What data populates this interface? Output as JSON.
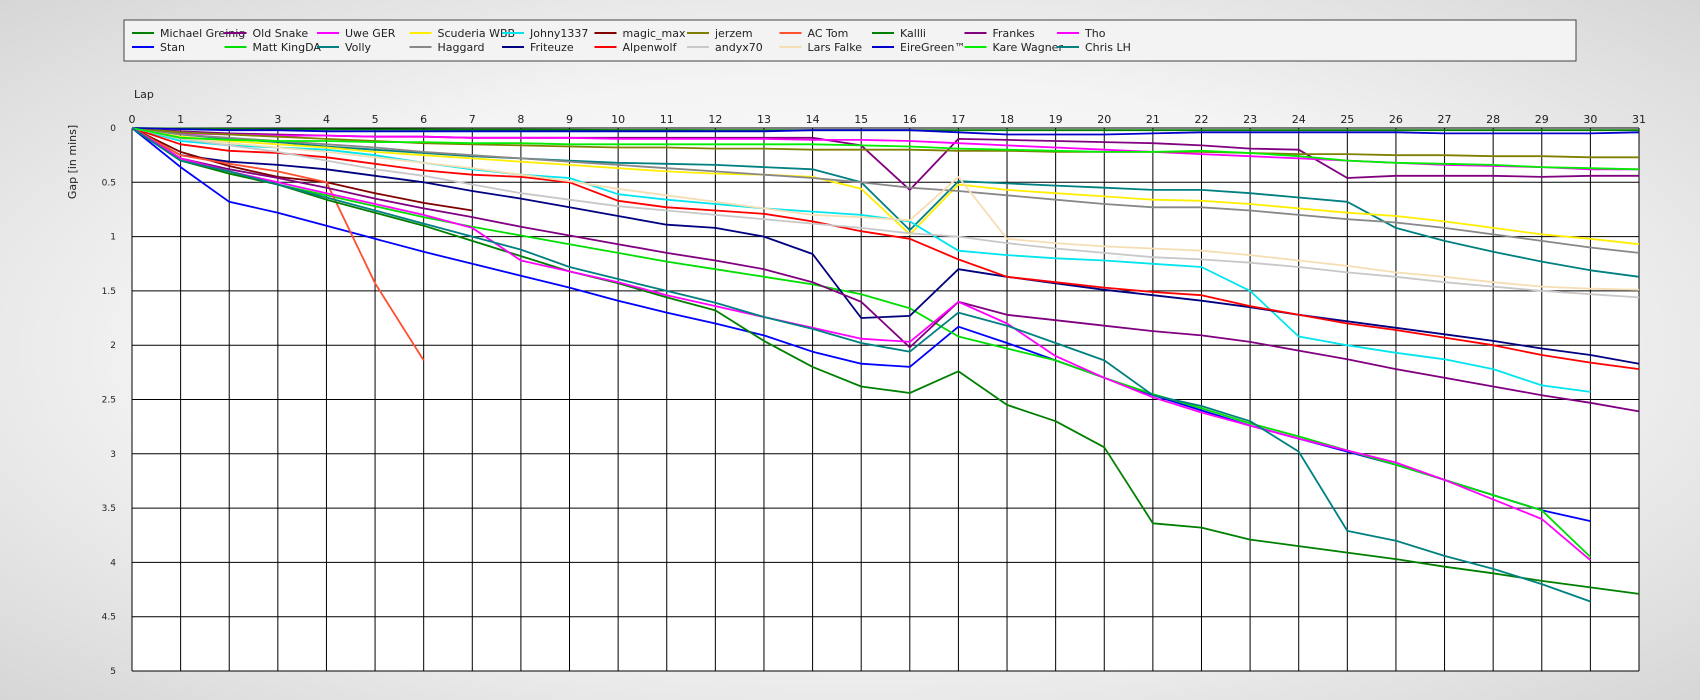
{
  "chart_data": {
    "type": "line",
    "xlabel": "Lap",
    "ylabel": "Gap [in mins]",
    "xlim": [
      0,
      31
    ],
    "ylim": [
      0,
      5
    ],
    "y_axis_inverted": true,
    "grid": true,
    "legend_position": "top",
    "x_ticks": [
      "0",
      "1",
      "2",
      "3",
      "4",
      "5",
      "6",
      "7",
      "8",
      "9",
      "10",
      "11",
      "12",
      "13",
      "14",
      "15",
      "16",
      "17",
      "18",
      "19",
      "20",
      "21",
      "22",
      "23",
      "24",
      "25",
      "26",
      "27",
      "28",
      "29",
      "30",
      "31"
    ],
    "y_ticks": [
      "0",
      "0.5",
      "1",
      "1.5",
      "2",
      "2.5",
      "3",
      "3.5",
      "4",
      "4.5",
      "5"
    ],
    "series": [
      {
        "name": "Michael Greinig",
        "color": "#008000",
        "values": [
          0,
          0.005,
          0.008,
          0.01,
          0.012,
          0.013,
          0.014,
          0.015,
          0.016,
          0.017,
          0.018,
          0.018,
          0.019,
          0.019,
          0.02,
          0.02,
          0.02,
          0.02,
          0.02,
          0.02,
          0.02,
          0.02,
          0.02,
          0.02,
          0.02,
          0.02,
          0.02,
          0.02,
          0.02,
          0.02,
          0.02,
          0.02
        ]
      },
      {
        "name": "Stan",
        "color": "#0000ff",
        "values": [
          0,
          0.36,
          0.68,
          0.78,
          0.9,
          1.02,
          1.14,
          1.25,
          1.36,
          1.47,
          1.59,
          1.7,
          1.8,
          1.91,
          2.06,
          2.17,
          2.2,
          1.83,
          1.98,
          2.14,
          2.3,
          2.46,
          2.6,
          2.74,
          2.86,
          2.98,
          3.1,
          3.24,
          3.38,
          3.52,
          3.62
        ]
      },
      {
        "name": "Old Snake",
        "color": "#800080",
        "values": [
          0,
          0.03,
          0.05,
          0.06,
          0.07,
          0.08,
          0.08,
          0.09,
          0.09,
          0.09,
          0.09,
          0.09,
          0.09,
          0.09,
          0.09,
          0.16,
          0.57,
          0.1,
          0.11,
          0.12,
          0.13,
          0.14,
          0.16,
          0.19,
          0.2,
          0.46,
          0.44,
          0.44,
          0.44,
          0.45,
          0.44,
          0.44
        ]
      },
      {
        "name": "Matt KingDA",
        "color": "#00dd00",
        "values": [
          0,
          0.28,
          0.42,
          0.52,
          0.62,
          0.72,
          0.82,
          0.91,
          0.99,
          1.07,
          1.15,
          1.23,
          1.3,
          1.37,
          1.44,
          1.53,
          1.66,
          1.92,
          2.03,
          2.14,
          2.3,
          2.45,
          2.58,
          2.72,
          2.84,
          2.97,
          3.1,
          3.24,
          3.38,
          3.52,
          3.95
        ]
      },
      {
        "name": "Uwe GER",
        "color": "#ff00ff",
        "values": [
          0,
          0.05,
          0.06,
          0.07,
          0.07,
          0.08,
          0.08,
          0.09,
          0.09,
          0.09,
          0.1,
          0.1,
          0.1,
          0.1,
          0.11,
          0.11,
          0.12,
          0.14,
          0.16,
          0.18,
          0.2,
          0.22,
          0.24,
          0.26,
          0.28,
          0.3,
          0.32,
          0.34,
          0.35,
          0.36,
          0.38,
          0.38
        ]
      },
      {
        "name": "Volly",
        "color": "#008080",
        "values": [
          0,
          0.06,
          0.1,
          0.13,
          0.17,
          0.2,
          0.23,
          0.26,
          0.28,
          0.3,
          0.32,
          0.33,
          0.34,
          0.36,
          0.38,
          0.5,
          0.94,
          0.49,
          0.51,
          0.53,
          0.55,
          0.57,
          0.57,
          0.6,
          0.64,
          0.68,
          0.92,
          1.04,
          1.14,
          1.23,
          1.31,
          1.37
        ]
      },
      {
        "name": "Scuderia WBB",
        "color": "#ffee00",
        "values": [
          0,
          0.08,
          0.12,
          0.15,
          0.18,
          0.22,
          0.25,
          0.28,
          0.31,
          0.34,
          0.37,
          0.4,
          0.42,
          0.43,
          0.45,
          0.56,
          0.98,
          0.52,
          0.57,
          0.6,
          0.63,
          0.66,
          0.67,
          0.7,
          0.74,
          0.78,
          0.81,
          0.86,
          0.92,
          0.98,
          1.02,
          1.07
        ]
      },
      {
        "name": "Haggard",
        "color": "#888888",
        "values": [
          0,
          0.06,
          0.09,
          0.12,
          0.15,
          0.18,
          0.22,
          0.25,
          0.28,
          0.31,
          0.34,
          0.37,
          0.4,
          0.43,
          0.46,
          0.5,
          0.55,
          0.58,
          0.62,
          0.66,
          0.7,
          0.73,
          0.73,
          0.76,
          0.8,
          0.84,
          0.87,
          0.92,
          0.98,
          1.04,
          1.1,
          1.15
        ]
      },
      {
        "name": "Johny1337",
        "color": "#00e5ee",
        "values": [
          0,
          0.12,
          0.16,
          0.18,
          0.2,
          0.25,
          0.32,
          0.38,
          0.43,
          0.46,
          0.61,
          0.66,
          0.7,
          0.74,
          0.77,
          0.8,
          0.86,
          1.13,
          1.17,
          1.2,
          1.22,
          1.25,
          1.28,
          1.5,
          1.92,
          2.0,
          2.07,
          2.13,
          2.22,
          2.37,
          2.43
        ]
      },
      {
        "name": "Friteuze",
        "color": "#000080",
        "values": [
          0,
          0.25,
          0.31,
          0.34,
          0.38,
          0.44,
          0.5,
          0.58,
          0.65,
          0.73,
          0.81,
          0.89,
          0.92,
          1.0,
          1.16,
          1.75,
          1.73,
          1.3,
          1.37,
          1.43,
          1.49,
          1.54,
          1.59,
          1.65,
          1.72,
          1.78,
          1.84,
          1.9,
          1.96,
          2.03,
          2.09,
          2.17
        ]
      },
      {
        "name": "magic_max",
        "color": "#800000",
        "values": [
          0,
          0.22,
          0.35,
          0.45,
          0.5,
          0.6,
          0.69,
          0.76
        ]
      },
      {
        "name": "Alpenwolf",
        "color": "#ff0000",
        "values": [
          0,
          0.15,
          0.21,
          0.23,
          0.27,
          0.33,
          0.39,
          0.43,
          0.45,
          0.5,
          0.67,
          0.73,
          0.76,
          0.79,
          0.86,
          0.95,
          1.02,
          1.21,
          1.37,
          1.42,
          1.47,
          1.51,
          1.54,
          1.64,
          1.72,
          1.8,
          1.86,
          1.93,
          2.0,
          2.09,
          2.16,
          2.22
        ]
      },
      {
        "name": "jerzem",
        "color": "#808000",
        "values": [
          0,
          0.04,
          0.06,
          0.08,
          0.1,
          0.12,
          0.14,
          0.15,
          0.16,
          0.17,
          0.18,
          0.18,
          0.19,
          0.19,
          0.2,
          0.2,
          0.2,
          0.21,
          0.21,
          0.22,
          0.22,
          0.22,
          0.22,
          0.23,
          0.24,
          0.24,
          0.25,
          0.25,
          0.26,
          0.26,
          0.27,
          0.27
        ]
      },
      {
        "name": "andyx70",
        "color": "#c8c8c8",
        "values": [
          0,
          0.1,
          0.16,
          0.22,
          0.3,
          0.38,
          0.44,
          0.52,
          0.6,
          0.66,
          0.72,
          0.76,
          0.8,
          0.84,
          0.88,
          0.92,
          0.97,
          1.0,
          1.06,
          1.11,
          1.15,
          1.19,
          1.21,
          1.24,
          1.28,
          1.33,
          1.37,
          1.42,
          1.46,
          1.5,
          1.53,
          1.56
        ]
      },
      {
        "name": "AC Tom",
        "color": "#ff5030",
        "values": [
          0,
          0.25,
          0.33,
          0.4,
          0.5,
          1.43,
          2.14
        ]
      },
      {
        "name": "Lars Falke",
        "color": "#f5deb3",
        "values": [
          0,
          0.09,
          0.14,
          0.18,
          0.22,
          0.27,
          0.32,
          0.37,
          0.43,
          0.49,
          0.56,
          0.62,
          0.68,
          0.74,
          0.8,
          0.82,
          0.85,
          0.45,
          1.02,
          1.06,
          1.09,
          1.11,
          1.13,
          1.17,
          1.22,
          1.27,
          1.33,
          1.37,
          1.42,
          1.46,
          1.48,
          1.49
        ]
      },
      {
        "name": "Kallli",
        "color": "#008000",
        "values": [
          0,
          0.3,
          0.42,
          0.52,
          0.66,
          0.78,
          0.9,
          1.04,
          1.18,
          1.32,
          1.43,
          1.56,
          1.68,
          1.96,
          2.2,
          2.38,
          2.44,
          2.24,
          2.55,
          2.7,
          2.94,
          3.64,
          3.68,
          3.79,
          3.85,
          3.91,
          3.97,
          4.04,
          4.1,
          4.17,
          4.23,
          4.29
        ]
      },
      {
        "name": "EireGreen™",
        "color": "#0000cd",
        "values": [
          0,
          0.01,
          0.02,
          0.02,
          0.03,
          0.03,
          0.03,
          0.03,
          0.03,
          0.03,
          0.03,
          0.03,
          0.03,
          0.03,
          0.02,
          0.02,
          0.02,
          0.04,
          0.06,
          0.06,
          0.06,
          0.05,
          0.04,
          0.04,
          0.04,
          0.04,
          0.04,
          0.05,
          0.05,
          0.05,
          0.05,
          0.04
        ]
      },
      {
        "name": "Frankes",
        "color": "#800080",
        "values": [
          0,
          0.28,
          0.38,
          0.46,
          0.55,
          0.65,
          0.74,
          0.82,
          0.91,
          0.99,
          1.07,
          1.15,
          1.22,
          1.3,
          1.42,
          1.6,
          2.02,
          1.6,
          1.72,
          1.77,
          1.82,
          1.87,
          1.91,
          1.97,
          2.05,
          2.13,
          2.22,
          2.3,
          2.38,
          2.46,
          2.53,
          2.61
        ]
      },
      {
        "name": "Kare Wagner",
        "color": "#00ee00",
        "values": [
          0,
          0.09,
          0.11,
          0.12,
          0.12,
          0.13,
          0.13,
          0.14,
          0.14,
          0.15,
          0.15,
          0.15,
          0.15,
          0.15,
          0.15,
          0.16,
          0.17,
          0.19,
          0.2,
          0.21,
          0.22,
          0.22,
          0.21,
          0.23,
          0.26,
          0.3,
          0.32,
          0.33,
          0.34,
          0.36,
          0.37,
          0.38
        ]
      },
      {
        "name": "Tho",
        "color": "#ff00ff",
        "values": [
          0,
          0.28,
          0.4,
          0.5,
          0.6,
          0.7,
          0.8,
          0.92,
          1.22,
          1.32,
          1.42,
          1.54,
          1.64,
          1.74,
          1.84,
          1.94,
          1.97,
          1.6,
          1.8,
          2.1,
          2.3,
          2.48,
          2.62,
          2.74,
          2.86,
          2.97,
          3.08,
          3.24,
          3.42,
          3.6,
          3.98
        ]
      },
      {
        "name": "Chris LH",
        "color": "#008080",
        "values": [
          0,
          0.3,
          0.4,
          0.52,
          0.64,
          0.76,
          0.88,
          1.0,
          1.12,
          1.28,
          1.39,
          1.5,
          1.61,
          1.74,
          1.85,
          1.98,
          2.06,
          1.7,
          1.82,
          1.98,
          2.14,
          2.46,
          2.56,
          2.7,
          2.98,
          3.71,
          3.8,
          3.94,
          4.06,
          4.2,
          4.36
        ]
      }
    ]
  }
}
